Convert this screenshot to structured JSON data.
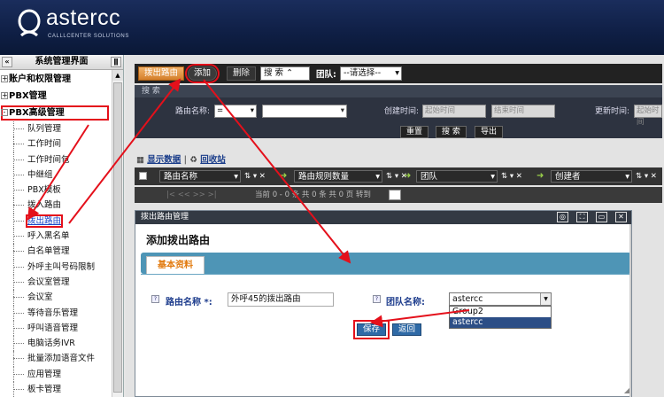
{
  "brand": {
    "name": "astercc",
    "tagline": "CALLLCENTER SOLUTIONS"
  },
  "sidebar": {
    "title": "系统管理界面",
    "collapse_glyph": "«",
    "pin_glyph": "ǁ",
    "groups": [
      {
        "label": "账户和权限管理",
        "toggle": "+"
      },
      {
        "label": "PBX管理",
        "toggle": "+"
      },
      {
        "label": "PBX高级管理",
        "toggle": "-"
      }
    ],
    "items": [
      "队列管理",
      "工作时间",
      "工作时间包",
      "中继组",
      "PBX模板",
      "拨入路由",
      "拨出路由",
      "呼入黑名单",
      "白名单管理",
      "外呼主叫号码限制",
      "会议室管理",
      "会议室",
      "等待音乐管理",
      "呼叫语音管理",
      "电脑话务IVR",
      "批量添加语音文件",
      "应用管理",
      "板卡管理"
    ],
    "selected_index": 6
  },
  "toolbar": {
    "route_label": "拨出路由",
    "add_label": "添加",
    "delete_label": "删除",
    "search_label": "搜 索",
    "team_label": "团队:",
    "team_value": "--请选择--"
  },
  "search": {
    "title": "搜 索",
    "route_name_label": "路由名称:",
    "op_value": "=",
    "created_label": "创建时间:",
    "from_placeholder": "起始时间",
    "to_placeholder": "结束时间",
    "updated_label": "更新时间:",
    "updated_placeholder": "起始时间",
    "reset": "重置",
    "search": "搜 索",
    "export": "导出"
  },
  "links": {
    "show_data": "显示数据",
    "recycle": "回收站"
  },
  "grid": {
    "columns": [
      "路由名称",
      "路由规则数量",
      "团队",
      "创建者"
    ],
    "sort_icons": "⇅ ▾ ✕",
    "pager": "当前 0 - 0 条 共 0 条 共 0 页 转到",
    "nav": "|<   <<   >>   >|"
  },
  "dialog": {
    "title": "拨出路由管理",
    "heading": "添加拨出路由",
    "tab": "基本资料",
    "name_label": "路由名称 *:",
    "name_value": "外呼45的拨出路由",
    "team_label": "团队名称:",
    "team_value": "astercc",
    "team_options": [
      "Group2",
      "astercc"
    ],
    "team_selected_index": 1,
    "save": "保存",
    "back": "返回"
  },
  "colors": {
    "annotation": "#e4101b",
    "header_bg": "#0f1f45",
    "tab_bar": "#4e95b6"
  }
}
